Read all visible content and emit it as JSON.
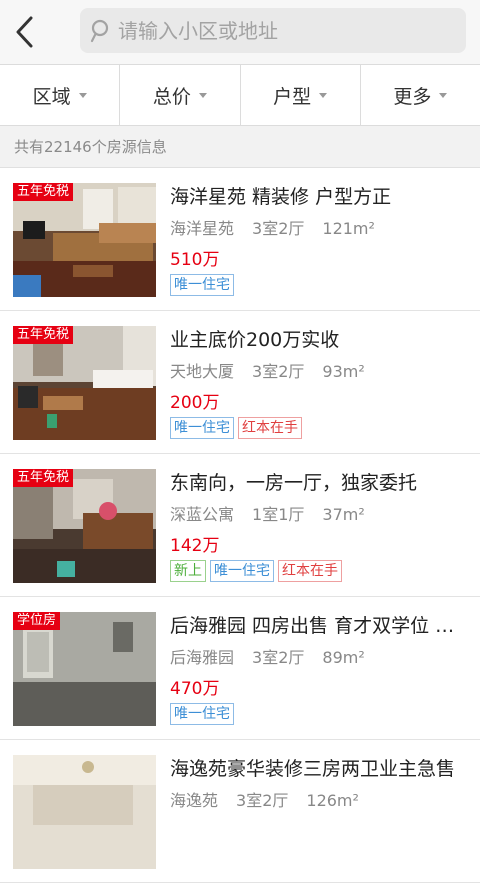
{
  "search": {
    "placeholder": "请输入小区或地址"
  },
  "filters": [
    {
      "label": "区域"
    },
    {
      "label": "总价"
    },
    {
      "label": "户型"
    },
    {
      "label": "更多"
    }
  ],
  "summary": "共有22146个房源信息",
  "listings": [
    {
      "badge": "五年免税",
      "title": "海洋星苑 精装修  户型方正",
      "community": "海洋星苑",
      "layout": "3室2厅",
      "area": "121m²",
      "price": "510万",
      "tags": [
        {
          "text": "唯一住宅",
          "color": "blue"
        }
      ]
    },
    {
      "badge": "五年免税",
      "title": "业主底价200万实收",
      "community": "天地大厦",
      "layout": "3室2厅",
      "area": "93m²",
      "price": "200万",
      "tags": [
        {
          "text": "唯一住宅",
          "color": "blue"
        },
        {
          "text": "红本在手",
          "color": "red"
        }
      ]
    },
    {
      "badge": "五年免税",
      "title": "东南向，一房一厅，独家委托",
      "community": "深蓝公寓",
      "layout": "1室1厅",
      "area": "37m²",
      "price": "142万",
      "tags": [
        {
          "text": "新上",
          "color": "green"
        },
        {
          "text": "唯一住宅",
          "color": "blue"
        },
        {
          "text": "红本在手",
          "color": "red"
        }
      ]
    },
    {
      "badge": "学位房",
      "title": "后海雅园 四房出售 育才双学位 湾…",
      "community": "后海雅园",
      "layout": "3室2厅",
      "area": "89m²",
      "price": "470万",
      "tags": [
        {
          "text": "唯一住宅",
          "color": "blue"
        }
      ]
    },
    {
      "badge": "",
      "title": "海逸苑豪华装修三房两卫业主急售",
      "community": "海逸苑",
      "layout": "3室2厅",
      "area": "126m²",
      "price": "",
      "tags": []
    }
  ],
  "colors": {
    "accent_red": "#e60012",
    "tag_blue": "#3d8fd6",
    "tag_red": "#e04040",
    "tag_green": "#4cae3a"
  }
}
